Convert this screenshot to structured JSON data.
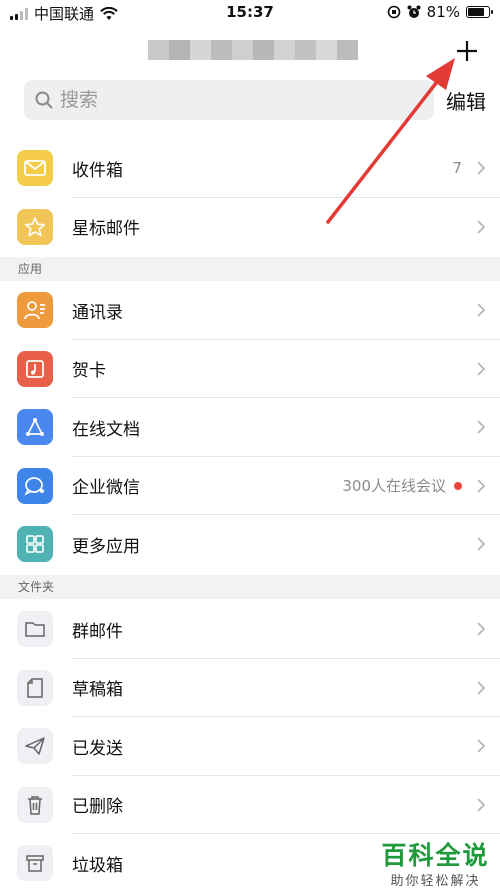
{
  "status_bar": {
    "carrier": "中国联通",
    "time": "15:37",
    "battery_pct": "81%",
    "battery_level": 0.81
  },
  "search": {
    "placeholder": "搜索",
    "value": ""
  },
  "header": {
    "edit_label": "编辑"
  },
  "mail": [
    {
      "label": "收件箱",
      "trail": "7",
      "icon": "envelope-icon",
      "color": "#f4cc4a"
    },
    {
      "label": "星标邮件",
      "trail": "",
      "icon": "star-icon",
      "color": "#f2c559"
    }
  ],
  "apps_header": "应用",
  "apps": [
    {
      "label": "通讯录",
      "trail": "",
      "icon": "contacts-icon",
      "color": "#ee9a3d"
    },
    {
      "label": "贺卡",
      "trail": "",
      "icon": "greeting-card-icon",
      "color": "#e8604a"
    },
    {
      "label": "在线文档",
      "trail": "",
      "icon": "document-share-icon",
      "color": "#4a87ef"
    },
    {
      "label": "企业微信",
      "trail": "300人在线会议",
      "icon": "wecom-icon",
      "color": "#3d85e8"
    },
    {
      "label": "更多应用",
      "trail": "",
      "icon": "grid-icon",
      "color": "#4fb3b4"
    }
  ],
  "folders_header": "文件夹",
  "folders": [
    {
      "label": "群邮件",
      "icon": "folder-icon"
    },
    {
      "label": "草稿箱",
      "icon": "draft-icon"
    },
    {
      "label": "已发送",
      "icon": "paper-plane-icon"
    },
    {
      "label": "已删除",
      "icon": "trash-icon"
    },
    {
      "label": "垃圾箱",
      "icon": "spam-bin-icon"
    }
  ],
  "watermark": {
    "title": "百科全说",
    "subtitle": "助你轻松解决"
  },
  "colors": {
    "accent_red": "#e8453c",
    "watermark_green": "#1e9a3d",
    "arrow_red": "#e23a35"
  }
}
